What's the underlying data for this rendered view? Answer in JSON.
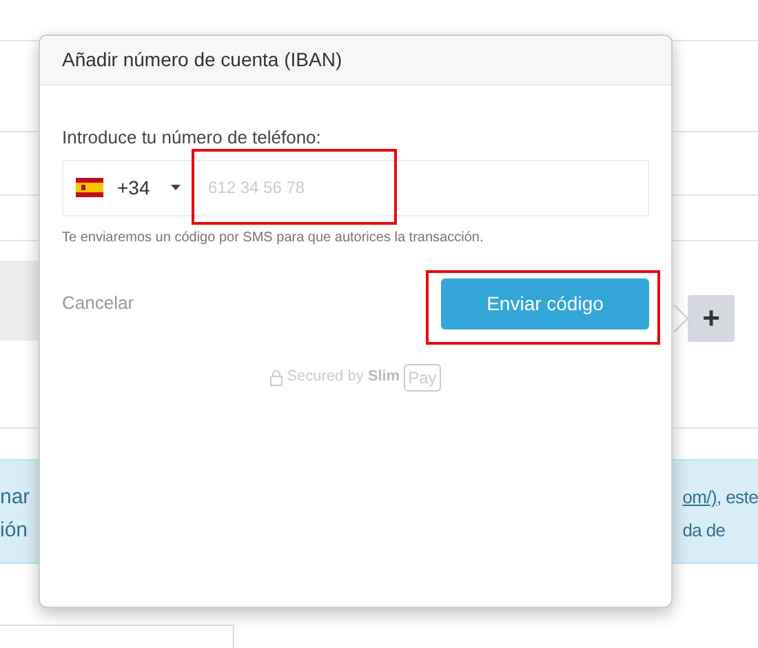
{
  "dialog": {
    "title": "Añadir número de cuenta (IBAN)",
    "phone_label": "Introduce tu número de teléfono:",
    "country_code": "+34",
    "phone_placeholder": "612 34 56 78",
    "hint": "Te enviaremos un código por SMS para que autorices la transacción.",
    "cancel": "Cancelar",
    "submit": "Enviar código",
    "secured_by": "Secured by",
    "brand_left": "Slim",
    "brand_right": "Pay"
  },
  "add_button": "+",
  "banner": {
    "lines": [
      {
        "left": "nar",
        "link": "om/)",
        "right": ", este"
      },
      {
        "left": "ión",
        "right": "da de"
      }
    ]
  }
}
